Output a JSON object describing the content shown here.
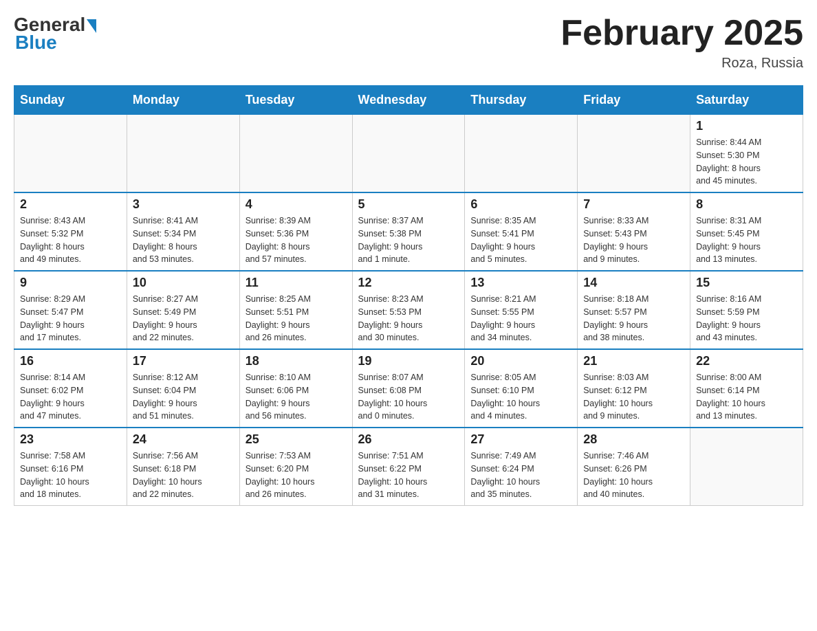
{
  "logo": {
    "general": "General",
    "blue": "Blue"
  },
  "title": "February 2025",
  "location": "Roza, Russia",
  "days_of_week": [
    "Sunday",
    "Monday",
    "Tuesday",
    "Wednesday",
    "Thursday",
    "Friday",
    "Saturday"
  ],
  "weeks": [
    [
      {
        "day": "",
        "info": ""
      },
      {
        "day": "",
        "info": ""
      },
      {
        "day": "",
        "info": ""
      },
      {
        "day": "",
        "info": ""
      },
      {
        "day": "",
        "info": ""
      },
      {
        "day": "",
        "info": ""
      },
      {
        "day": "1",
        "info": "Sunrise: 8:44 AM\nSunset: 5:30 PM\nDaylight: 8 hours\nand 45 minutes."
      }
    ],
    [
      {
        "day": "2",
        "info": "Sunrise: 8:43 AM\nSunset: 5:32 PM\nDaylight: 8 hours\nand 49 minutes."
      },
      {
        "day": "3",
        "info": "Sunrise: 8:41 AM\nSunset: 5:34 PM\nDaylight: 8 hours\nand 53 minutes."
      },
      {
        "day": "4",
        "info": "Sunrise: 8:39 AM\nSunset: 5:36 PM\nDaylight: 8 hours\nand 57 minutes."
      },
      {
        "day": "5",
        "info": "Sunrise: 8:37 AM\nSunset: 5:38 PM\nDaylight: 9 hours\nand 1 minute."
      },
      {
        "day": "6",
        "info": "Sunrise: 8:35 AM\nSunset: 5:41 PM\nDaylight: 9 hours\nand 5 minutes."
      },
      {
        "day": "7",
        "info": "Sunrise: 8:33 AM\nSunset: 5:43 PM\nDaylight: 9 hours\nand 9 minutes."
      },
      {
        "day": "8",
        "info": "Sunrise: 8:31 AM\nSunset: 5:45 PM\nDaylight: 9 hours\nand 13 minutes."
      }
    ],
    [
      {
        "day": "9",
        "info": "Sunrise: 8:29 AM\nSunset: 5:47 PM\nDaylight: 9 hours\nand 17 minutes."
      },
      {
        "day": "10",
        "info": "Sunrise: 8:27 AM\nSunset: 5:49 PM\nDaylight: 9 hours\nand 22 minutes."
      },
      {
        "day": "11",
        "info": "Sunrise: 8:25 AM\nSunset: 5:51 PM\nDaylight: 9 hours\nand 26 minutes."
      },
      {
        "day": "12",
        "info": "Sunrise: 8:23 AM\nSunset: 5:53 PM\nDaylight: 9 hours\nand 30 minutes."
      },
      {
        "day": "13",
        "info": "Sunrise: 8:21 AM\nSunset: 5:55 PM\nDaylight: 9 hours\nand 34 minutes."
      },
      {
        "day": "14",
        "info": "Sunrise: 8:18 AM\nSunset: 5:57 PM\nDaylight: 9 hours\nand 38 minutes."
      },
      {
        "day": "15",
        "info": "Sunrise: 8:16 AM\nSunset: 5:59 PM\nDaylight: 9 hours\nand 43 minutes."
      }
    ],
    [
      {
        "day": "16",
        "info": "Sunrise: 8:14 AM\nSunset: 6:02 PM\nDaylight: 9 hours\nand 47 minutes."
      },
      {
        "day": "17",
        "info": "Sunrise: 8:12 AM\nSunset: 6:04 PM\nDaylight: 9 hours\nand 51 minutes."
      },
      {
        "day": "18",
        "info": "Sunrise: 8:10 AM\nSunset: 6:06 PM\nDaylight: 9 hours\nand 56 minutes."
      },
      {
        "day": "19",
        "info": "Sunrise: 8:07 AM\nSunset: 6:08 PM\nDaylight: 10 hours\nand 0 minutes."
      },
      {
        "day": "20",
        "info": "Sunrise: 8:05 AM\nSunset: 6:10 PM\nDaylight: 10 hours\nand 4 minutes."
      },
      {
        "day": "21",
        "info": "Sunrise: 8:03 AM\nSunset: 6:12 PM\nDaylight: 10 hours\nand 9 minutes."
      },
      {
        "day": "22",
        "info": "Sunrise: 8:00 AM\nSunset: 6:14 PM\nDaylight: 10 hours\nand 13 minutes."
      }
    ],
    [
      {
        "day": "23",
        "info": "Sunrise: 7:58 AM\nSunset: 6:16 PM\nDaylight: 10 hours\nand 18 minutes."
      },
      {
        "day": "24",
        "info": "Sunrise: 7:56 AM\nSunset: 6:18 PM\nDaylight: 10 hours\nand 22 minutes."
      },
      {
        "day": "25",
        "info": "Sunrise: 7:53 AM\nSunset: 6:20 PM\nDaylight: 10 hours\nand 26 minutes."
      },
      {
        "day": "26",
        "info": "Sunrise: 7:51 AM\nSunset: 6:22 PM\nDaylight: 10 hours\nand 31 minutes."
      },
      {
        "day": "27",
        "info": "Sunrise: 7:49 AM\nSunset: 6:24 PM\nDaylight: 10 hours\nand 35 minutes."
      },
      {
        "day": "28",
        "info": "Sunrise: 7:46 AM\nSunset: 6:26 PM\nDaylight: 10 hours\nand 40 minutes."
      },
      {
        "day": "",
        "info": ""
      }
    ]
  ]
}
